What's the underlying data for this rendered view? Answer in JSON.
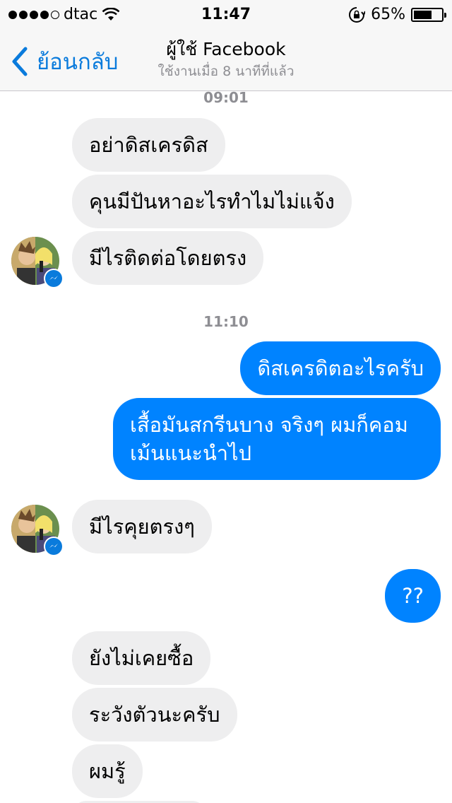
{
  "status_bar": {
    "carrier": "dtac",
    "time": "11:47",
    "battery": "65%",
    "battery_level": 0.65,
    "signal_bars": 4
  },
  "nav": {
    "back_label": "ย้อนกลับ",
    "title": "ผู้ใช้ Facebook",
    "subtitle": "ใช้งานเมื่อ 8 นาทีที่แล้ว"
  },
  "messages": {
    "timestamp_1": "09:01",
    "in_1": "อย่าดิสเครดิส",
    "in_2": "คุนมีปันหาอะไรทำไมไม่แจ้ง",
    "in_3": "มีไรติดต่อโดยตรง",
    "timestamp_2": "11:10",
    "out_1": "ดิสเครดิตอะไรครับ",
    "out_2": "เสื้อมันสกรีนบาง จริงๆ ผมก็คอมเม้นแนะนำไป",
    "in_4": "มีไรคุยตรงๆ",
    "out_3": "??",
    "in_5": "ยังไม่เคยซื้อ",
    "in_6": "ระวังตัวนะครับ",
    "in_7": "ผมรู้"
  },
  "colors": {
    "accent": "#0a7bdc",
    "outgoing_bubble": "#0083ff",
    "incoming_bubble": "#eeeeef"
  },
  "icons": [
    "back-chevron-icon",
    "wifi-icon",
    "rotation-lock-icon",
    "battery-icon",
    "messenger-icon"
  ]
}
